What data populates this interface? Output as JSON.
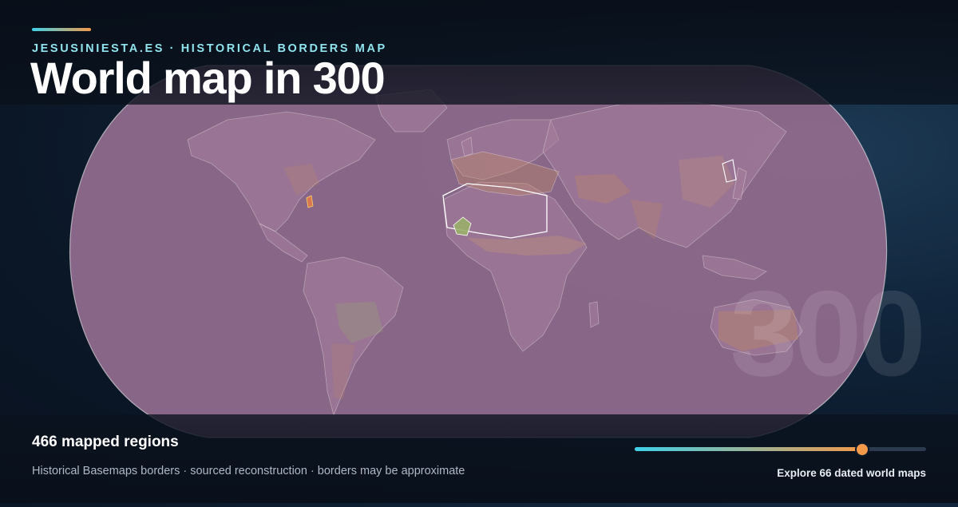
{
  "header": {
    "eyebrow": "JESUSINIESTA.ES · HISTORICAL BORDERS MAP",
    "title": "World map in 300"
  },
  "map": {
    "year_watermark": "300",
    "ocean_fill": "#8f6a8c",
    "land_fill": "#a77f9e",
    "border_color": "#ffffff",
    "highlight_colors": [
      "#d6a468",
      "#c48b5f",
      "#9ab06a",
      "#e07a4a"
    ]
  },
  "footer": {
    "regions_label": "466 mapped regions",
    "credits": "Historical Basemaps borders · sourced reconstruction · borders may be approximate",
    "explore_label": "Explore 66 dated world maps",
    "timeline_progress": 0.78
  },
  "colors": {
    "accent_start": "#3fd0e8",
    "accent_end": "#f2994a",
    "eyebrow": "#8fe4ee",
    "knob": "#f2994a"
  }
}
